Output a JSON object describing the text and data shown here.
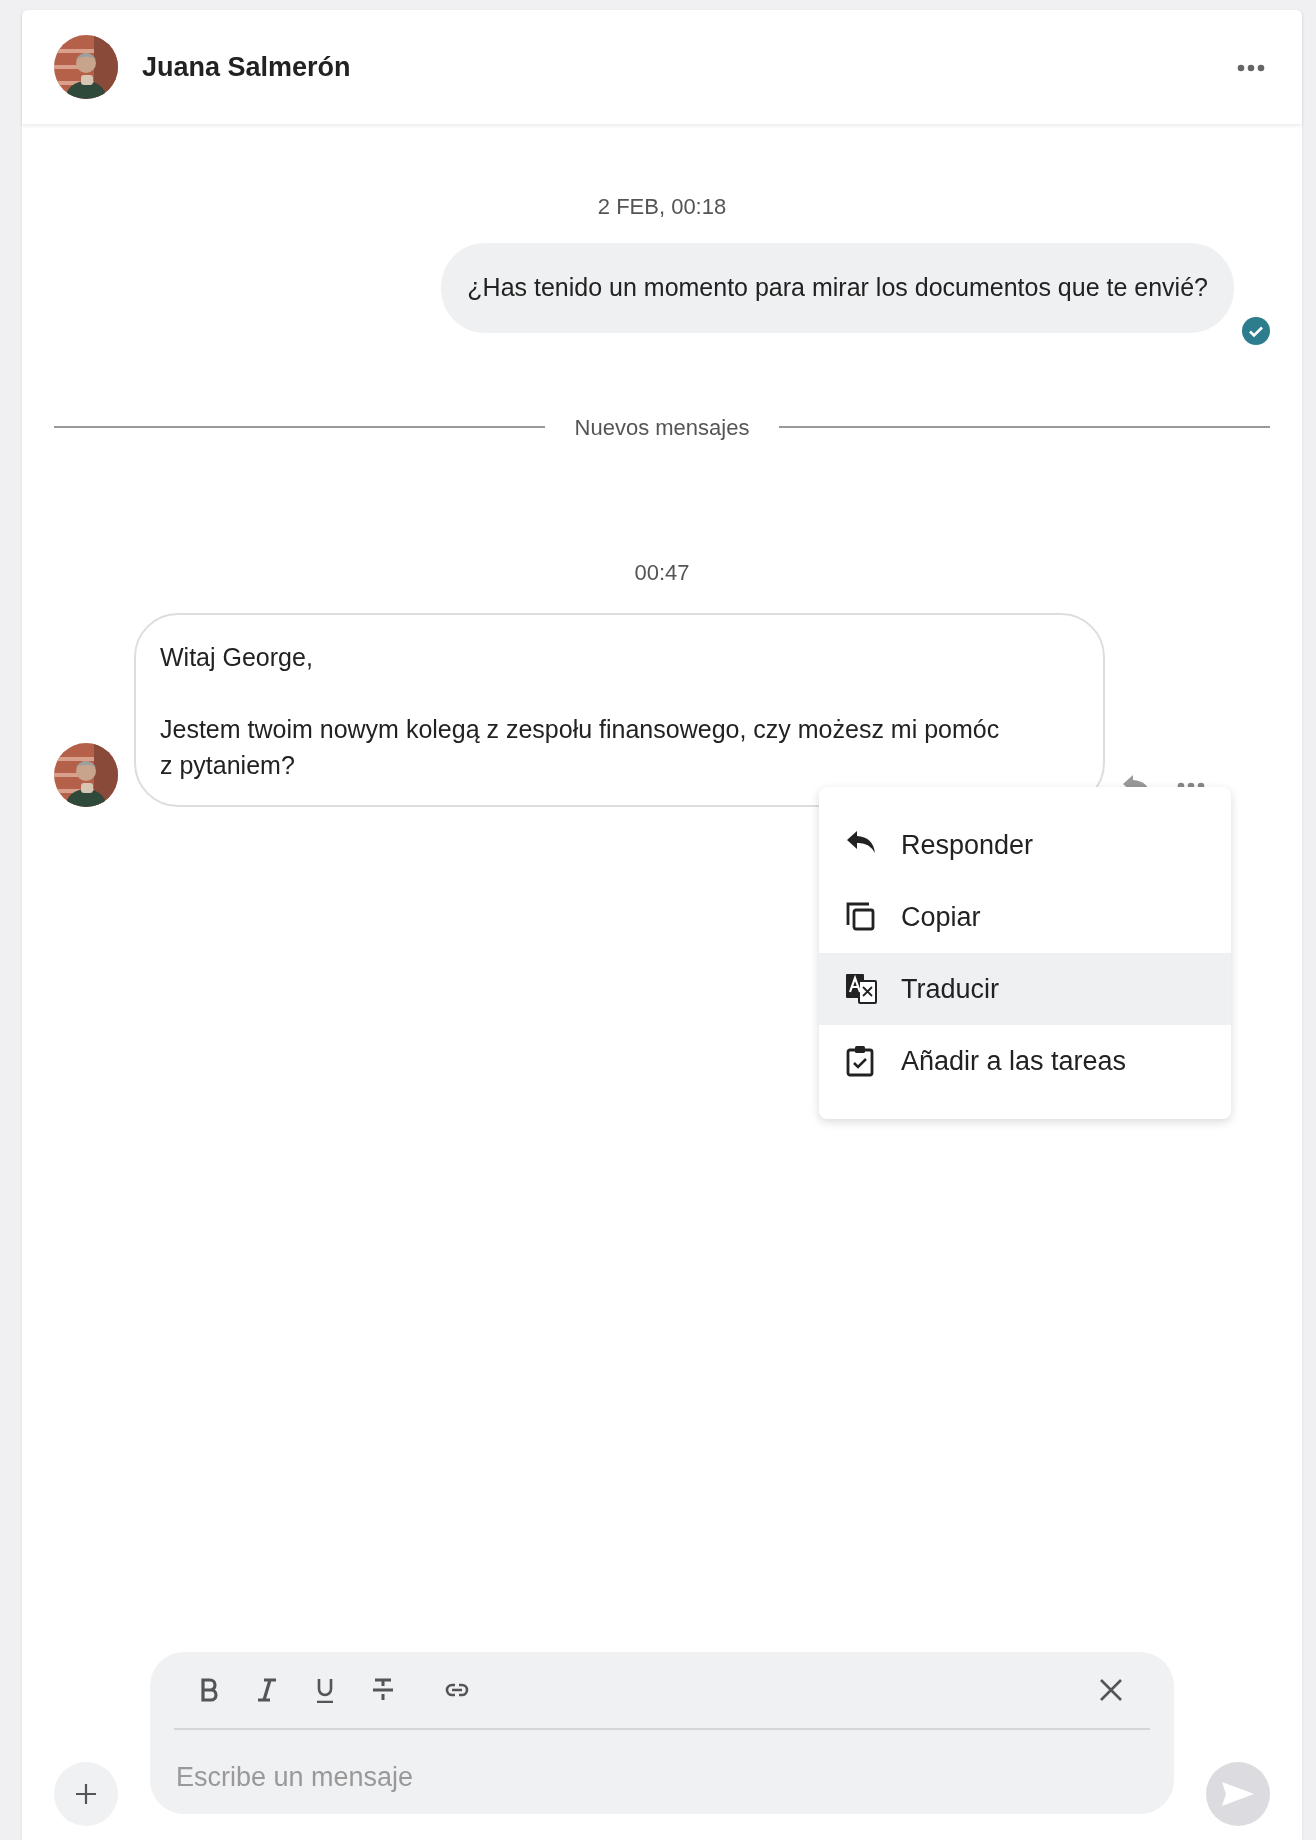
{
  "header": {
    "name": "Juana Salmerón"
  },
  "messages": [
    {
      "kind": "date",
      "text": "2 FEB, 00:18"
    },
    {
      "kind": "outgoing",
      "text": "¿Has tenido un momento para mirar los documentos que te envié?",
      "read": true
    },
    {
      "kind": "divider",
      "text": "Nuevos mensajes"
    },
    {
      "kind": "date",
      "text": "00:47"
    },
    {
      "kind": "incoming",
      "paragraphs": [
        "Witaj George,",
        "Jestem twoim nowym kolegą z zespołu finansowego, czy możesz mi pomóc z pytaniem?"
      ]
    }
  ],
  "context_menu": {
    "items": [
      {
        "label": "Responder",
        "selected": false
      },
      {
        "label": "Copiar",
        "selected": false
      },
      {
        "label": "Traducir",
        "selected": true
      },
      {
        "label": "Añadir a las tareas",
        "selected": false
      }
    ]
  },
  "composer": {
    "placeholder": "Escribe un mensaje"
  }
}
